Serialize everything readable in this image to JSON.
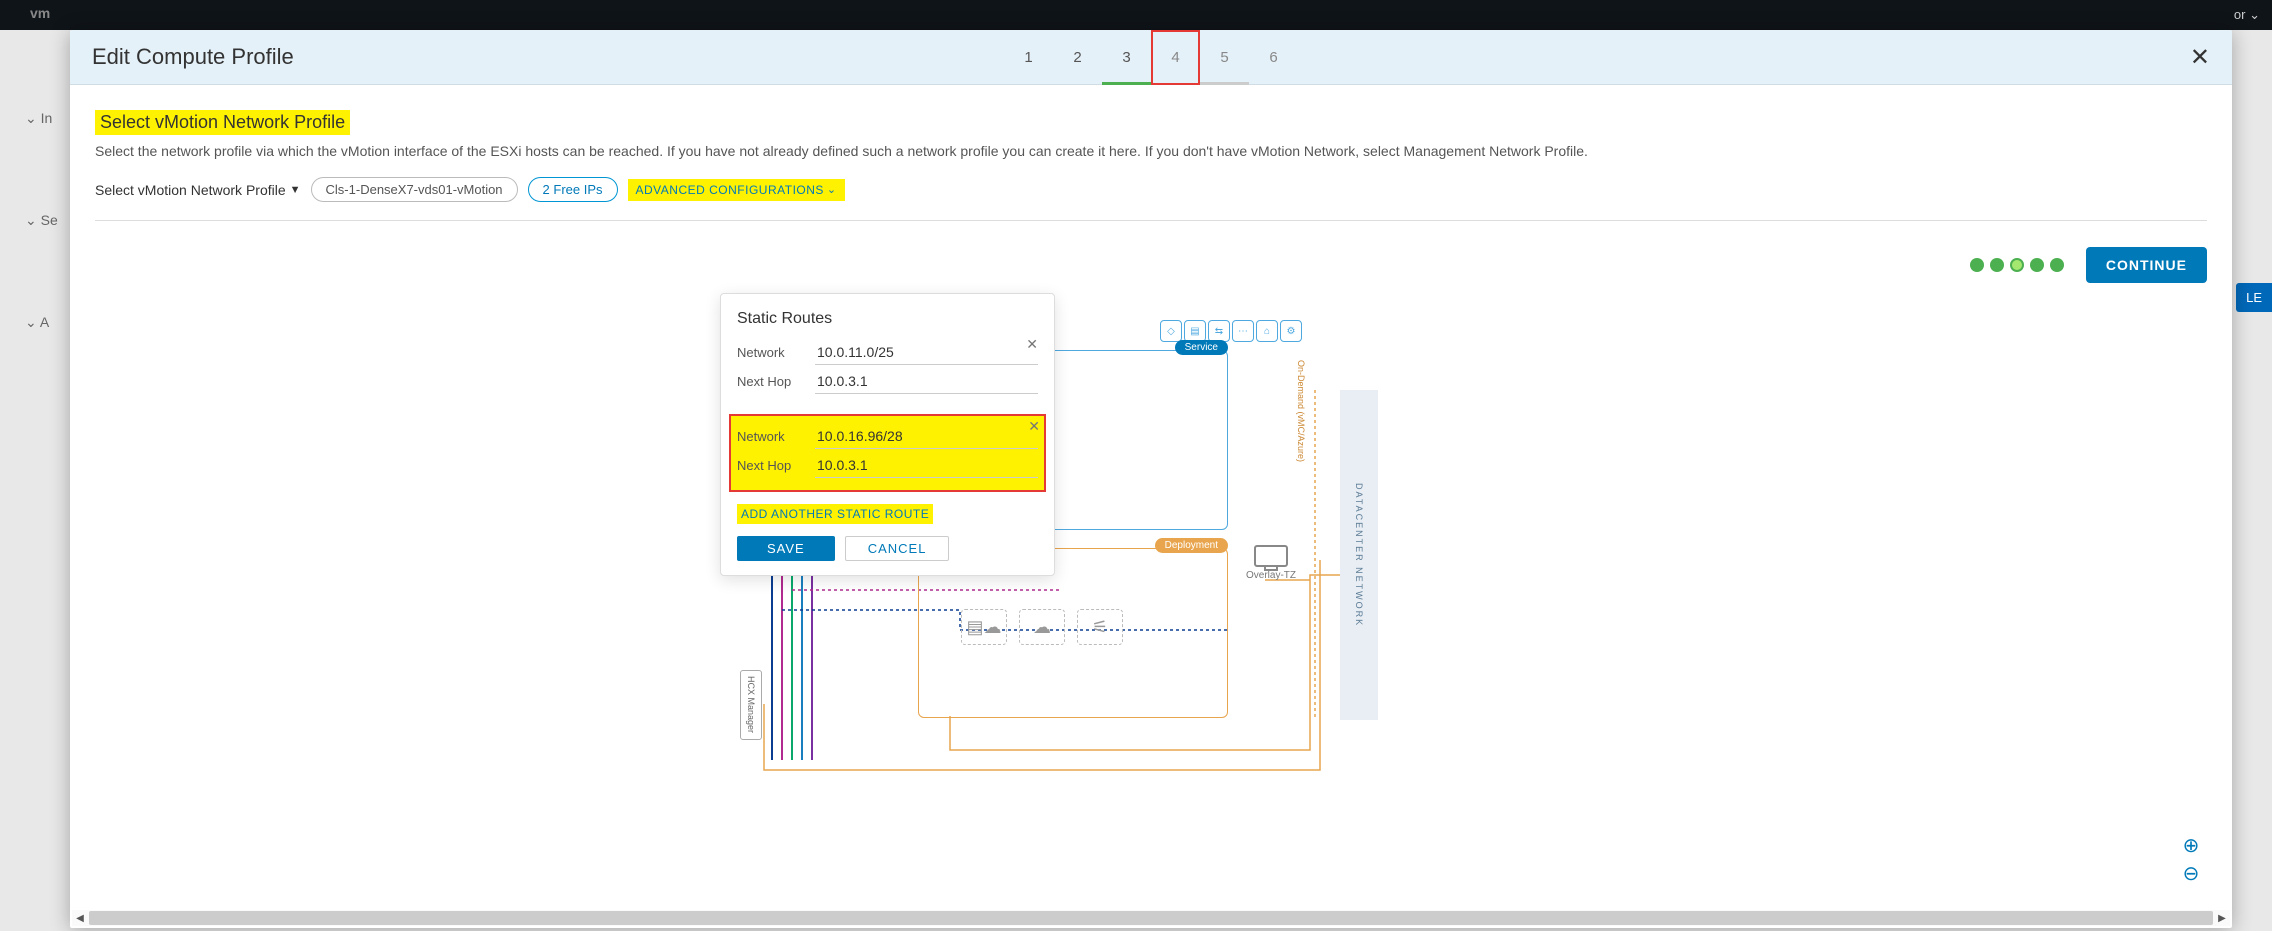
{
  "topbar": {
    "logo": "vm",
    "user_suffix": "or ⌄"
  },
  "backdrop": {
    "sidebar_item1": "In",
    "sidebar_item2": "Se",
    "sidebar_item3": "A",
    "badge": "LE"
  },
  "modal": {
    "title": "Edit Compute Profile",
    "steps": [
      "1",
      "2",
      "3",
      "4",
      "5",
      "6"
    ],
    "close": "✕"
  },
  "section": {
    "title": "Select vMotion Network Profile",
    "desc": "Select the network profile via which the vMotion interface of the ESXi hosts can be reached. If you have not already defined such a network profile you can create it here. If you don't have vMotion Network, select Management Network Profile.",
    "label": "Select vMotion Network Profile",
    "pill_profile": "Cls-1-DenseX7-vds01-vMotion",
    "pill_ips": "2 Free IPs",
    "adv": "ADVANCED CONFIGURATIONS"
  },
  "continue": "CONTINUE",
  "popup": {
    "title": "Static Routes",
    "label_network": "Network",
    "label_nexthop": "Next Hop",
    "routes": [
      {
        "network": "10.0.11.0/25",
        "nexthop": "10.0.3.1"
      },
      {
        "network": "10.0.16.96/28",
        "nexthop": "10.0.3.1"
      }
    ],
    "add": "ADD ANOTHER STATIC ROUTE",
    "save": "SAVE",
    "cancel": "CANCEL"
  },
  "diagram": {
    "service": "Service",
    "deployment": "Deployment",
    "ov": "Overlay-TZ",
    "hcx": "HCX Manager",
    "dc": "DATACENTER NETWORK",
    "vsvc": "On-Demand (vMC/Azure)"
  }
}
